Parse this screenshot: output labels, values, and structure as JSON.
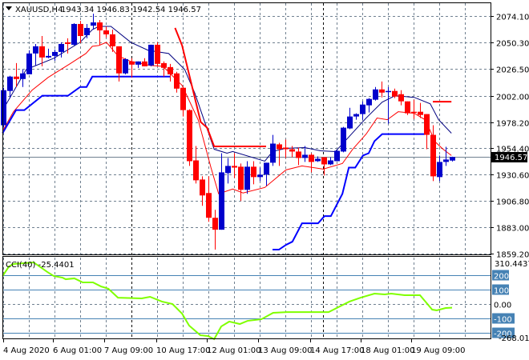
{
  "header": {
    "symbol": "XAUUSD,H4",
    "ohlc": "1943.34 1946.83 1942.54 1946.57"
  },
  "price_axis": [
    "2074.10",
    "2050.30",
    "2026.50",
    "2002.00",
    "1978.20",
    "1954.40",
    "1930.60",
    "1906.80",
    "1883.00",
    "1859.20"
  ],
  "current_price": "1946.57",
  "cci": {
    "title": "CCI(40) -25.4401",
    "max_label": "310.4437",
    "min_label": "-268.0187",
    "levels": [
      "200",
      "100",
      "0.00",
      "-100",
      "-200"
    ]
  },
  "time_axis": [
    "4 Aug 2020",
    "6 Aug 01:00",
    "7 Aug 09:00",
    "10 Aug 17:00",
    "12 Aug 01:00",
    "13 Aug 09:00",
    "14 Aug 17:00",
    "18 Aug 01:00",
    "19 Aug 09:00"
  ],
  "colors": {
    "bull": "#0000cc",
    "bear": "#ff0000",
    "ma_fast": "#000080",
    "ma_slow": "#ff0000",
    "stop_up": "#0000ff",
    "stop_down": "#ff0000",
    "cci": "#7fff00",
    "level": "#4682b4",
    "grid": "#708090"
  },
  "chart_data": {
    "type": "candlestick",
    "title": "XAUUSD,H4",
    "ylim": [
      1859.2,
      2074.1
    ],
    "candles_ohlc": [
      [
        1975.3,
        2009.2,
        1973.1,
        2007.0
      ],
      [
        2006.3,
        2020.0,
        1999.8,
        2019.3
      ],
      [
        2019.3,
        2031.5,
        2009.9,
        2017.1
      ],
      [
        2017.1,
        2025.8,
        2009.9,
        2022.2
      ],
      [
        2021.4,
        2043.1,
        2021.4,
        2040.2
      ],
      [
        2040.2,
        2048.8,
        2029.4,
        2046.7
      ],
      [
        2046.7,
        2056.0,
        2028.6,
        2036.6
      ],
      [
        2036.6,
        2044.5,
        2035.9,
        2038.0
      ],
      [
        2038.0,
        2043.8,
        2033.7,
        2041.6
      ],
      [
        2041.6,
        2050.3,
        2036.6,
        2048.8
      ],
      [
        2050.3,
        2053.9,
        2040.2,
        2048.8
      ],
      [
        2048.1,
        2067.6,
        2047.4,
        2066.9
      ],
      [
        2066.9,
        2069.7,
        2049.6,
        2056.0
      ],
      [
        2056.8,
        2066.9,
        2053.9,
        2063.3
      ],
      [
        2065.4,
        2076.2,
        2061.8,
        2068.3
      ],
      [
        2068.3,
        2070.5,
        2047.4,
        2061.1
      ],
      [
        2061.1,
        2064.7,
        2054.6,
        2057.5
      ],
      [
        2057.5,
        2061.8,
        2041.6,
        2046.7
      ],
      [
        2046.7,
        2046.7,
        2014.9,
        2022.2
      ],
      [
        2022.2,
        2035.9,
        2021.4,
        2035.1
      ],
      [
        2033.0,
        2035.9,
        2018.5,
        2030.1
      ],
      [
        2030.1,
        2033.0,
        2027.2,
        2033.0
      ],
      [
        2033.0,
        2035.9,
        2028.6,
        2028.6
      ],
      [
        2029.4,
        2048.1,
        2028.6,
        2048.1
      ],
      [
        2048.1,
        2050.3,
        2028.6,
        2030.8
      ],
      [
        2031.5,
        2033.0,
        2019.3,
        2027.2
      ],
      [
        2027.9,
        2030.8,
        2014.9,
        2021.4
      ],
      [
        2022.2,
        2023.6,
        2004.8,
        2008.4
      ],
      [
        2009.2,
        2009.2,
        1983.2,
        1989.0
      ],
      [
        1989.0,
        1989.7,
        1938.5,
        1942.8
      ],
      [
        1943.5,
        1956.5,
        1922.6,
        1925.5
      ],
      [
        1926.2,
        1929.1,
        1902.4,
        1911.8
      ],
      [
        1914.0,
        1929.1,
        1888.0,
        1891.6
      ],
      [
        1891.6,
        1898.8,
        1862.8,
        1880.8
      ],
      [
        1880.8,
        1950.0,
        1880.8,
        1932.7
      ],
      [
        1932.0,
        1945.7,
        1922.6,
        1938.5
      ],
      [
        1938.5,
        1950.0,
        1927.7,
        1937.0
      ],
      [
        1937.8,
        1940.7,
        1906.8,
        1916.9
      ],
      [
        1916.9,
        1942.8,
        1913.3,
        1937.8
      ],
      [
        1937.8,
        1942.8,
        1921.9,
        1928.4
      ],
      [
        1928.4,
        1937.0,
        1924.8,
        1930.6
      ],
      [
        1930.6,
        1941.4,
        1920.5,
        1941.4
      ],
      [
        1941.4,
        1966.6,
        1938.5,
        1958.7
      ],
      [
        1958.0,
        1959.4,
        1938.5,
        1953.6
      ],
      [
        1955.1,
        1962.3,
        1945.7,
        1953.6
      ],
      [
        1953.6,
        1956.5,
        1946.4,
        1951.5
      ],
      [
        1951.5,
        1955.1,
        1939.2,
        1945.7
      ],
      [
        1945.7,
        1956.5,
        1942.1,
        1948.6
      ],
      [
        1948.6,
        1950.0,
        1932.7,
        1942.1
      ],
      [
        1942.8,
        1947.1,
        1942.1,
        1945.0
      ],
      [
        1946.4,
        1946.4,
        1929.8,
        1939.9
      ],
      [
        1939.9,
        1946.4,
        1939.2,
        1943.5
      ],
      [
        1942.8,
        1952.9,
        1942.8,
        1952.2
      ],
      [
        1951.5,
        1973.8,
        1950.8,
        1973.1
      ],
      [
        1972.4,
        1991.1,
        1971.7,
        1983.2
      ],
      [
        1983.2,
        1986.1,
        1980.3,
        1985.4
      ],
      [
        1985.4,
        1996.9,
        1980.3,
        1994.0
      ],
      [
        1993.3,
        1999.8,
        1986.8,
        1999.1
      ],
      [
        1998.4,
        2009.9,
        1997.6,
        2007.7
      ],
      [
        2007.7,
        2014.9,
        2000.5,
        2004.8
      ],
      [
        2005.6,
        2009.9,
        1976.7,
        2006.3
      ],
      [
        2006.3,
        2008.4,
        1999.8,
        2001.2
      ],
      [
        2003.4,
        2007.0,
        1993.3,
        1996.9
      ],
      [
        1996.9,
        1996.9,
        1984.6,
        1986.1
      ],
      [
        1987.5,
        1998.4,
        1981.0,
        1986.8
      ],
      [
        1987.5,
        1995.5,
        1981.8,
        1984.6
      ],
      [
        1985.4,
        1985.4,
        1953.6,
        1966.6
      ],
      [
        1966.6,
        1975.3,
        1924.8,
        1929.1
      ],
      [
        1928.4,
        1947.9,
        1924.8,
        1942.1
      ],
      [
        1942.1,
        1955.8,
        1938.5,
        1944.3
      ],
      [
        1943.34,
        1946.83,
        1942.54,
        1946.57
      ]
    ],
    "ma_fast": [
      [
        0,
        1989.7
      ],
      [
        3.6,
        2025.8
      ],
      [
        7.9,
        2035.9
      ],
      [
        12,
        2050.3
      ],
      [
        13.9,
        2061.8
      ],
      [
        14.9,
        2064.7
      ],
      [
        16.8,
        2064.7
      ],
      [
        19.9,
        2050.3
      ],
      [
        22.6,
        2043.1
      ],
      [
        25.8,
        2040.2
      ],
      [
        28.3,
        2025.8
      ],
      [
        29.9,
        2004.1
      ],
      [
        31.6,
        1975.3
      ],
      [
        32.9,
        1953.6
      ],
      [
        34.9,
        1950.0
      ],
      [
        35.8,
        1951.5
      ],
      [
        40.8,
        1942.8
      ],
      [
        42,
        1951.5
      ],
      [
        44.1,
        1954.4
      ],
      [
        47,
        1955.1
      ],
      [
        49.5,
        1952.2
      ],
      [
        51.8,
        1951.5
      ],
      [
        53.3,
        1960.9
      ],
      [
        56.6,
        1981.8
      ],
      [
        59.1,
        1996.2
      ],
      [
        61.1,
        2002.0
      ],
      [
        64.1,
        2000.5
      ],
      [
        66.6,
        1994.7
      ],
      [
        67.9,
        1980.3
      ],
      [
        69.9,
        1968.1
      ]
    ],
    "ma_slow": [
      [
        0,
        1971.0
      ],
      [
        1.6,
        1987.5
      ],
      [
        4.5,
        2007.0
      ],
      [
        7,
        2018.5
      ],
      [
        10.4,
        2030.8
      ],
      [
        12.9,
        2040.2
      ],
      [
        13.9,
        2046.7
      ],
      [
        14.9,
        2047.4
      ],
      [
        16.1,
        2050.3
      ],
      [
        17.9,
        2038.0
      ],
      [
        19.9,
        2033.0
      ],
      [
        22.9,
        2029.4
      ],
      [
        24.9,
        2028.6
      ],
      [
        27.9,
        2011.3
      ],
      [
        30.4,
        1980.3
      ],
      [
        32.4,
        1937.0
      ],
      [
        33.6,
        1913.3
      ],
      [
        35.8,
        1917.6
      ],
      [
        37.4,
        1914.0
      ],
      [
        40.8,
        1919.0
      ],
      [
        44.1,
        1934.9
      ],
      [
        46.6,
        1938.5
      ],
      [
        49.9,
        1935.6
      ],
      [
        52.9,
        1940.7
      ],
      [
        54.5,
        1953.6
      ],
      [
        56.6,
        1967.3
      ],
      [
        58.3,
        1981.8
      ],
      [
        59.9,
        1980.3
      ],
      [
        61.6,
        1987.5
      ],
      [
        64.1,
        1986.1
      ],
      [
        65.8,
        1980.3
      ],
      [
        67.4,
        1960.1
      ],
      [
        68.6,
        1953.6
      ],
      [
        69.9,
        1947.9
      ]
    ],
    "stop_up": [
      [
        [
          -0.1,
          1968.1
        ],
        [
          2,
          1989.0
        ],
        [
          3.3,
          1989.0
        ],
        [
          6.1,
          2002.0
        ],
        [
          10.1,
          2002.0
        ],
        [
          12,
          2009.9
        ],
        [
          13,
          2009.9
        ],
        [
          13.9,
          2019.3
        ],
        [
          26,
          2019.3
        ]
      ],
      [
        [
          42,
          1862.8
        ],
        [
          43,
          1862.8
        ],
        [
          44.1,
          1867.1
        ],
        [
          45.1,
          1870.0
        ],
        [
          46.6,
          1886.6
        ],
        [
          49.1,
          1886.6
        ],
        [
          50.1,
          1893.1
        ],
        [
          51.1,
          1893.1
        ],
        [
          52.9,
          1913.3
        ],
        [
          53.9,
          1937.0
        ],
        [
          54.9,
          1937.0
        ],
        [
          56.1,
          1947.9
        ],
        [
          57,
          1950.0
        ],
        [
          57.9,
          1960.9
        ],
        [
          59.1,
          1967.3
        ],
        [
          65.8,
          1967.3
        ]
      ]
    ],
    "stop_down": [
      [
        [
          26.8,
          2063.3
        ],
        [
          27.9,
          2047.4
        ],
        [
          29.5,
          2009.2
        ],
        [
          30.8,
          1978.2
        ],
        [
          31.8,
          1973.1
        ],
        [
          32.9,
          1956.2
        ],
        [
          41,
          1956.2
        ]
      ],
      [
        [
          67,
          1996.6
        ],
        [
          69.9,
          1996.6
        ]
      ]
    ],
    "cci_ylim": [
      -268.0187,
      310.4437
    ],
    "cci_values": [
      [
        -0.1,
        194
      ],
      [
        0.9,
        261
      ],
      [
        1.6,
        278
      ],
      [
        4.75,
        289
      ],
      [
        6.9,
        222
      ],
      [
        7.9,
        194
      ],
      [
        9.25,
        183
      ],
      [
        9.75,
        172
      ],
      [
        11.1,
        178
      ],
      [
        12.4,
        150
      ],
      [
        14,
        150
      ],
      [
        15.25,
        122
      ],
      [
        16.4,
        106
      ],
      [
        17.9,
        44
      ],
      [
        21.6,
        39
      ],
      [
        22.9,
        50
      ],
      [
        24.75,
        17
      ],
      [
        26.4,
        0
      ],
      [
        27.9,
        -67
      ],
      [
        29,
        -150
      ],
      [
        30.75,
        -217
      ],
      [
        31.9,
        -222
      ],
      [
        32.9,
        -244
      ],
      [
        34,
        -156
      ],
      [
        35.25,
        -122
      ],
      [
        36.9,
        -139
      ],
      [
        38.1,
        -117
      ],
      [
        40.25,
        -106
      ],
      [
        42.1,
        -61
      ],
      [
        44.25,
        -56
      ],
      [
        50.75,
        -56
      ],
      [
        54,
        17
      ],
      [
        55.75,
        44
      ],
      [
        57.9,
        72
      ],
      [
        59.5,
        67
      ],
      [
        60.5,
        72
      ],
      [
        62.6,
        61
      ],
      [
        65,
        61
      ],
      [
        66.9,
        -39
      ],
      [
        67.6,
        -44
      ],
      [
        69,
        -28
      ],
      [
        70,
        -25.44
      ]
    ],
    "cci_levels": [
      200,
      100,
      0,
      -100,
      -200
    ]
  }
}
